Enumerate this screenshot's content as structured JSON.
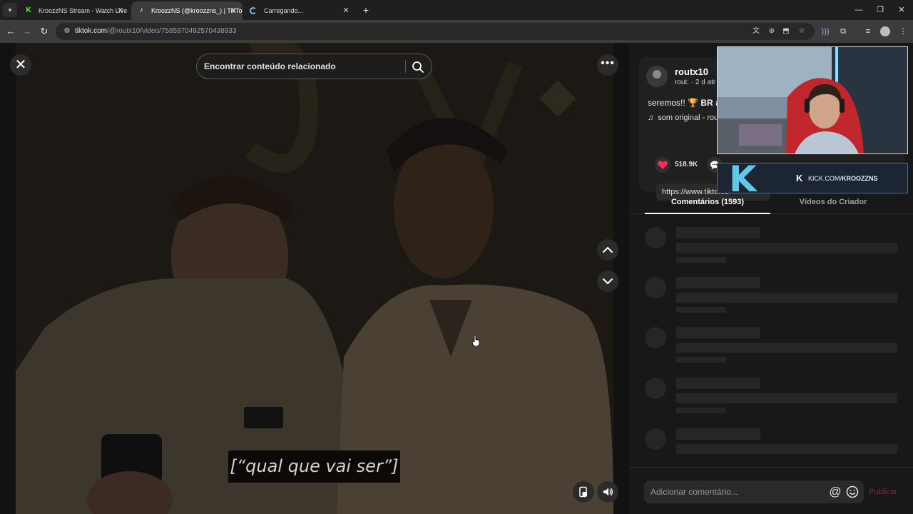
{
  "browser": {
    "tabs": [
      {
        "title": "KroozzNS Stream - Watch Live",
        "favicon": "kick-icon",
        "active": false
      },
      {
        "title": "KroozzNS (@kroozzns_) | TikTok",
        "favicon": "tiktok-icon",
        "active": true
      },
      {
        "title": "Carregando...",
        "favicon": "loading-spinner-icon",
        "active": false
      }
    ],
    "url_host": "tiktok.com",
    "url_path": "/@routx10/video/7585970492570438933"
  },
  "video": {
    "search_placeholder": "Encontrar conteúdo relacionado",
    "caption": "[“qual que vai ser”]"
  },
  "post": {
    "username": "routx10",
    "user_meta": "rout. · 2 d atr",
    "description": "seremos!! 🏆",
    "description_tag": "BR #r",
    "music": "som original - rou",
    "likes": "518.9K",
    "link": "https://www.tiktok.c"
  },
  "tabs": {
    "comments": "Comentários (1593)",
    "creator_videos": "Vídeos do Criador"
  },
  "comment_box": {
    "placeholder": "Adicionar comentário...",
    "publish": "Publicar"
  },
  "overlay": {
    "kick_url_prefix": "KICK.COM/",
    "kick_url_name": "KROOZZNS"
  },
  "colors": {
    "like_red": "#fe2c55",
    "kick_green": "#53fc18",
    "publish_disabled": "#7a2a38"
  }
}
